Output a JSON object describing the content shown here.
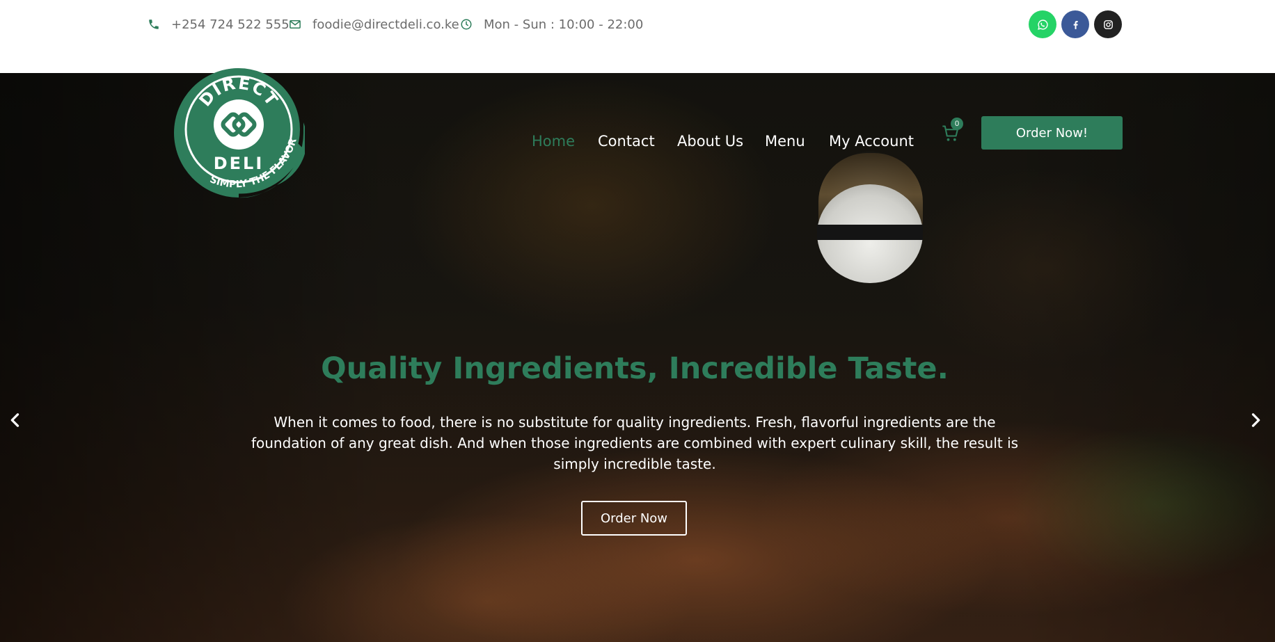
{
  "topbar": {
    "phone": "+254 724 522 555",
    "email": "foodie@directdeli.co.ke",
    "hours": "Mon - Sun : 10:00 - 22:00",
    "social": [
      {
        "name": "whatsapp-icon",
        "color": "#25d366"
      },
      {
        "name": "facebook-icon",
        "color": "#3b5998"
      },
      {
        "name": "instagram-icon",
        "color": "#222222"
      }
    ]
  },
  "logo": {
    "top_text": "DIRECT",
    "bottom_text": "DELI",
    "tagline": "SIMPLY THE FLAVOR"
  },
  "nav": {
    "items": [
      "Home",
      "Contact",
      "About Us",
      "Menu",
      "My Account"
    ],
    "active": "Home",
    "cart_count": "0",
    "order_button": "Order Now!"
  },
  "hero": {
    "title": "Quality Ingredients, Incredible Taste.",
    "text": "When it comes to food, there is no substitute for quality ingredients. Fresh, flavorful ingredients are the foundation of any great dish. And when those ingredients are combined with expert culinary skill, the result is simply incredible taste.",
    "button": "Order Now"
  },
  "colors": {
    "accent": "#2e7d5b",
    "topbar_text": "#6b6b6b"
  }
}
